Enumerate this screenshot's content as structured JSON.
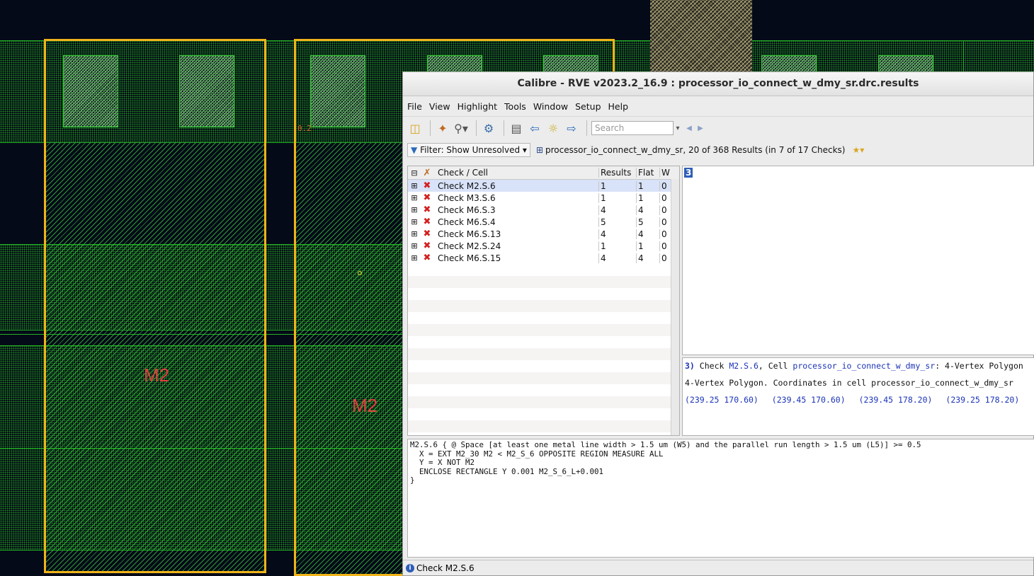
{
  "canvas": {
    "labels": [
      {
        "text": "M2"
      },
      {
        "text": "M2"
      }
    ],
    "ruler_text": "0.2",
    "highlight_color": "#f0b419",
    "metal_color": "#23b423"
  },
  "window": {
    "title": "Calibre - RVE v2023.2_16.9 : processor_io_connect_w_dmy_sr.drc.results",
    "menu": [
      "File",
      "View",
      "Highlight",
      "Tools",
      "Window",
      "Setup",
      "Help"
    ],
    "search_placeholder": "Search",
    "filter_label": "Filter: Show Unresolved",
    "summary": "processor_io_connect_w_dmy_sr, 20 of 368 Results (in 7 of 17 Checks)",
    "table": {
      "headers": {
        "name": "Check / Cell",
        "results": "Results",
        "flat": "Flat",
        "w": "W"
      },
      "rows": [
        {
          "name": "Check M2.S.6",
          "results": "1",
          "flat": "1",
          "w": "0"
        },
        {
          "name": "Check M3.S.6",
          "results": "1",
          "flat": "1",
          "w": "0"
        },
        {
          "name": "Check M6.S.3",
          "results": "4",
          "flat": "4",
          "w": "0"
        },
        {
          "name": "Check M6.S.4",
          "results": "5",
          "flat": "5",
          "w": "0"
        },
        {
          "name": "Check M6.S.13",
          "results": "4",
          "flat": "4",
          "w": "0"
        },
        {
          "name": "Check M2.S.24",
          "results": "1",
          "flat": "1",
          "w": "0"
        },
        {
          "name": "Check M6.S.15",
          "results": "4",
          "flat": "4",
          "w": "0"
        }
      ]
    },
    "result_index": "3",
    "info": {
      "index": "3)",
      "check_prefix": "Check",
      "check_link": "M2.S.6",
      "cell_prefix": ", Cell",
      "cell_link": "processor_io_connect_w_dmy_sr",
      "shape": ": 4-Vertex Polygon",
      "line2": "4-Vertex Polygon. Coordinates in cell processor_io_connect_w_dmy_sr",
      "coords": [
        "(239.25 170.60)",
        "(239.45 170.60)",
        "(239.45 178.20)",
        "(239.25 178.20)"
      ]
    },
    "rule_text": "M2.S.6 { @ Space [at least one metal line width > 1.5 um (W5) and the parallel run length > 1.5 um (L5)] >= 0.5\n  X = EXT M2_30 M2 < M2_S_6 OPPOSITE REGION MEASURE ALL\n  Y = X NOT M2\n  ENCLOSE RECTANGLE Y 0.001 M2_S_6_L+0.001\n}",
    "status": "Check M2.S.6"
  }
}
